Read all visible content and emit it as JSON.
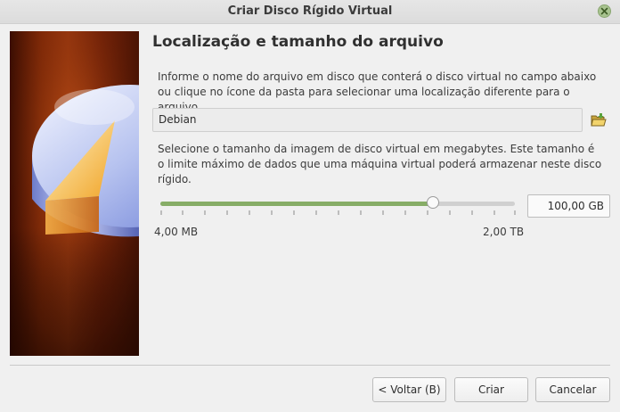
{
  "window": {
    "title": "Criar Disco Rígido Virtual"
  },
  "page": {
    "heading": "Localização e tamanho do arquivo",
    "location_description": "Informe o nome do arquivo em disco que conterá o disco virtual no campo abaixo ou clique no ícone da pasta para selecionar uma localização diferente para o arquivo.",
    "file_name": "Debian",
    "size_description": "Selecione o tamanho da imagem de disco virtual em megabytes. Este tamanho é o limite máximo de dados que uma máquina virtual poderá armazenar neste disco rígido.",
    "size_value": "100,00 GB",
    "slider_fraction": 0.77,
    "range_min": "4,00 MB",
    "range_max": "2,00 TB"
  },
  "buttons": {
    "back": "< Voltar (B)",
    "create": "Criar",
    "cancel": "Cancelar"
  },
  "colors": {
    "accent": "#87ad67",
    "side_image_base": "#8b2d08"
  },
  "icons": {
    "close": "close-icon",
    "folder": "folder-open-icon"
  }
}
